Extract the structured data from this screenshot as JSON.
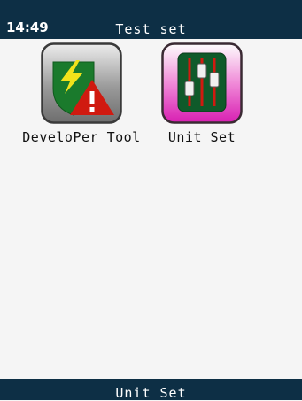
{
  "status_bar": {
    "time": "14:49",
    "title": "Test set"
  },
  "apps": [
    {
      "label": "DeveloPer Tool",
      "icon": "developer-shield-warning-icon"
    },
    {
      "label": "Unit Set",
      "icon": "sliders-icon"
    }
  ],
  "bottom_bar": {
    "label": "Unit Set"
  },
  "colors": {
    "bar_background": "#0d2f45",
    "screen_background": "#f5f5f5",
    "unit_set_tile": "#d81fb2",
    "shield_green": "#1a7a2c",
    "warning_red": "#d01a10"
  }
}
